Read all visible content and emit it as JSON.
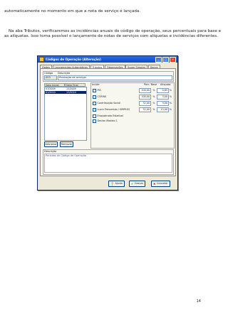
{
  "document": {
    "paragraph1": "automaticamente no momento em que a nota de serviço é lançada.",
    "paragraph2": "Na aba Tributos, verificaremos as incidências anuais do código de operação, seus percentuais para base e as alíquotas. Isso torna possível o lançamento de notas de serviços com alíquotas e incidências diferentes.",
    "page_number": "14"
  },
  "dialog": {
    "title": "Códigos de Operação (Alteração)",
    "tabs": [
      "Dados",
      "Lançamentos Automáticos",
      "Tributos",
      "Observações",
      "Super Simples",
      "Dacon"
    ],
    "active_tab": "Tributos",
    "codigo_label": "Código",
    "descricao_label": "Descrição",
    "codigo_value": "003",
    "descricao_value": "Prestação de serviços",
    "grid_headers": [
      "Data Inicial",
      "Data Final"
    ],
    "grid_rows": [
      {
        "inicial": "01/2009",
        "final": "12/2009"
      },
      {
        "inicial": "01/2010",
        "final": "12/2010"
      }
    ],
    "incide_label": "Incide",
    "perc_base_label": "Perc. Base",
    "aliquota_label": "Alíquota",
    "tributos": [
      {
        "name": "PIS",
        "checked": true,
        "base": "100,00",
        "aliq": "0,65"
      },
      {
        "name": "COFINS",
        "checked": true,
        "base": "100,00",
        "aliq": "3,00"
      },
      {
        "name": "Contribuição Social",
        "checked": true,
        "base": "32,00",
        "aliq": "9,00"
      },
      {
        "name": "Lucro Presumido / SIMPLES",
        "checked": true,
        "base": "32,00",
        "aliq": "15,00"
      }
    ],
    "percent_sign": "%",
    "enquadrado_label": "Enquadrado Estadual",
    "declan_label": "Declan Modelo 1",
    "adicionar_label": "Adicionar",
    "remover_label": "Remover",
    "descricao_box_label": "Descrição",
    "descricao_box_text": "Períodos do Código de Operação",
    "ajuda_label": "Ajuda",
    "gravar_label": "Gravar",
    "cancelar_label": "Cancelar",
    "check_mark": "✓"
  }
}
